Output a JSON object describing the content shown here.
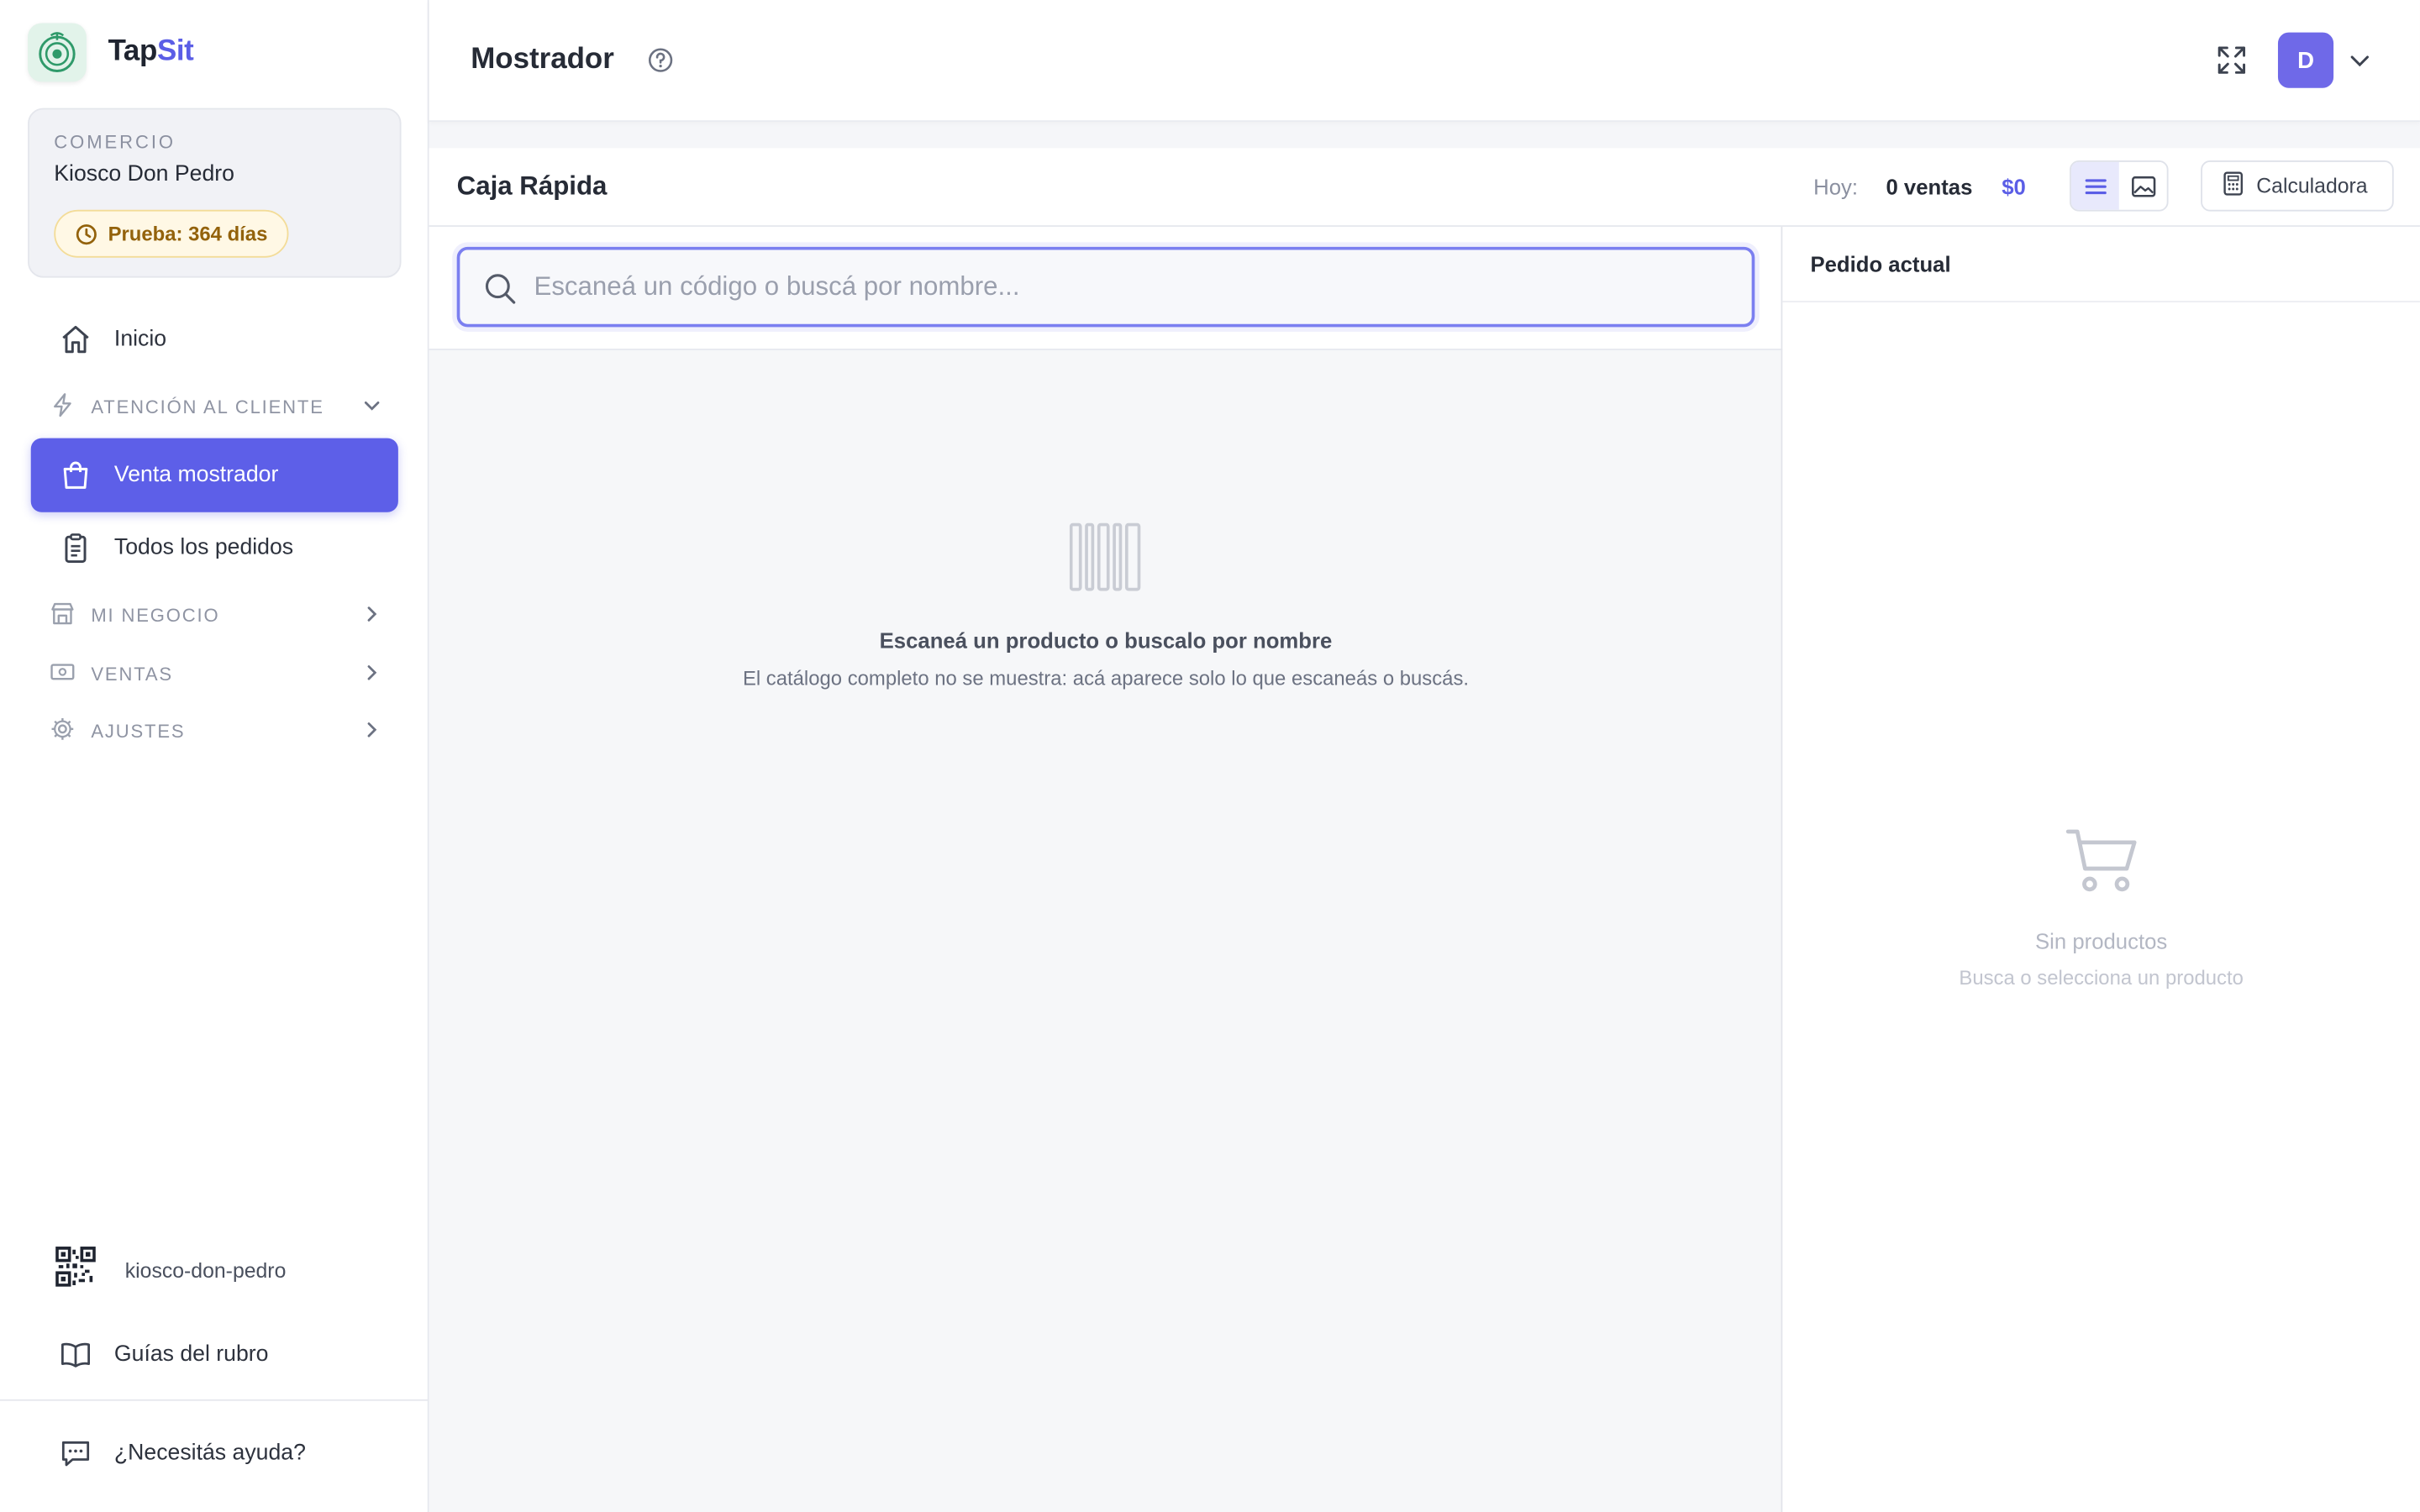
{
  "brand": {
    "name_part1": "Tap",
    "name_part2": "Sit",
    "accent_color": "#5b5ee6"
  },
  "merchant": {
    "label": "COMERCIO",
    "name": "Kiosco Don Pedro",
    "trial": "Prueba: 364 días"
  },
  "nav": {
    "inicio": "Inicio",
    "section_atencion": "ATENCIÓN AL CLIENTE",
    "venta_mostrador": "Venta mostrador",
    "todos_pedidos": "Todos los pedidos",
    "section_negocio": "MI NEGOCIO",
    "section_ventas": "VENTAS",
    "section_ajustes": "AJUSTES",
    "active_color": "#5d5fe8"
  },
  "footer": {
    "slug": "kiosco-don-pedro",
    "guias": "Guías del rubro",
    "ayuda": "¿Necesitás ayuda?"
  },
  "header": {
    "title": "Mostrador",
    "avatar_initial": "D"
  },
  "caja": {
    "title": "Caja Rápida",
    "today_label": "Hoy:",
    "today_sales": "0 ventas",
    "today_amount": "$0",
    "calculator_label": "Calculadora"
  },
  "search": {
    "placeholder": "Escaneá un código o buscá por nombre..."
  },
  "empty": {
    "title": "Escaneá un producto o buscalo por nombre",
    "subtitle": "El catálogo completo no se muestra: acá aparece solo lo que escaneás o buscás."
  },
  "order": {
    "title": "Pedido actual",
    "empty_title": "Sin productos",
    "empty_subtitle": "Busca o selecciona un producto"
  }
}
